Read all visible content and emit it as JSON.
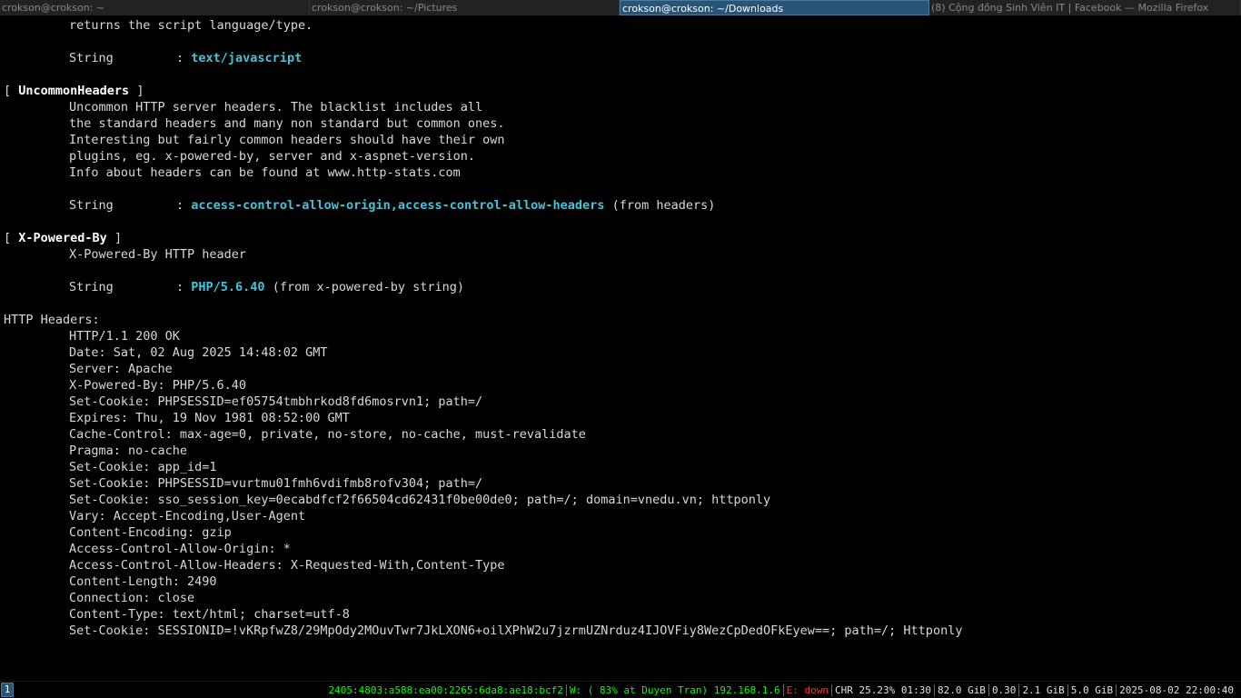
{
  "tabs": [
    {
      "title": "crokson@crokson: ~",
      "active": false
    },
    {
      "title": "crokson@crokson: ~/Pictures",
      "active": false
    },
    {
      "title": "crokson@crokson: ~/Downloads",
      "active": true
    },
    {
      "title": "(8) Cộng đồng Sinh Viên IT | Facebook — Mozilla Firefox",
      "active": false
    }
  ],
  "terminal": {
    "script_type": {
      "desc": "returns the script language/type.",
      "key": "String",
      "colon": ":",
      "value": "text/javascript"
    },
    "uncommon_headers": {
      "open": "[ ",
      "name": "UncommonHeaders",
      "close": " ]",
      "desc": [
        "Uncommon HTTP server headers. The blacklist includes all",
        "the standard headers and many non standard but common ones.",
        "Interesting but fairly common headers should have their own",
        "plugins, eg. x-powered-by, server and x-aspnet-version.",
        "Info about headers can be found at www.http-stats.com"
      ],
      "key": "String",
      "colon": ":",
      "value": "access-control-allow-origin,access-control-allow-headers",
      "suffix": " (from headers)"
    },
    "x_powered_by": {
      "open": "[ ",
      "name": "X-Powered-By",
      "close": " ]",
      "desc": "X-Powered-By HTTP header",
      "key": "String",
      "colon": ":",
      "value": "PHP/5.6.40",
      "suffix": " (from x-powered-by string)"
    },
    "http_headers_title": "HTTP Headers:",
    "http_headers": [
      "HTTP/1.1 200 OK",
      "Date: Sat, 02 Aug 2025 14:48:02 GMT",
      "Server: Apache",
      "X-Powered-By: PHP/5.6.40",
      "Set-Cookie: PHPSESSID=ef05754tmbhrkod8fd6mosrvn1; path=/",
      "Expires: Thu, 19 Nov 1981 08:52:00 GMT",
      "Cache-Control: max-age=0, private, no-store, no-cache, must-revalidate",
      "Pragma: no-cache",
      "Set-Cookie: app_id=1",
      "Set-Cookie: PHPSESSID=vurtmu01fmh6vdifmb8rofv304; path=/",
      "Set-Cookie: sso_session_key=0ecabdfcf2f66504cd62431f0be00de0; path=/; domain=vnedu.vn; httponly",
      "Vary: Accept-Encoding,User-Agent",
      "Content-Encoding: gzip",
      "Access-Control-Allow-Origin: *",
      "Access-Control-Allow-Headers: X-Requested-With,Content-Type",
      "Content-Length: 2490",
      "Connection: close",
      "Content-Type: text/html; charset=utf-8",
      "Set-Cookie: SESSIONID=!vKRpfwZ8/29MpOdy2MOuvTwr7JkLXON6+oilXPhW2u7jzrmUZNrduz4IJOVFiy8WezCpDedOFkEyew==; path=/; Httponly"
    ]
  },
  "statusbar": {
    "workspace": "1",
    "ipv6": "2405:4803:a588:ea00:2265:6da8:ae18:bcf2",
    "wifi": "W: ( 83% at Duyen Tran) 192.168.1.6",
    "ethernet": "E: down",
    "battery": "CHR 25.23% 01:30",
    "disk": "82.0 GiB",
    "load": "0.30",
    "mem_used": "2.1 GiB",
    "mem_free": "5.0 GiB",
    "datetime": "2025-08-02 22:00:40",
    "colors": {
      "ok": "#00ff00",
      "bad": "#ff3030",
      "accent": "#285577",
      "value_cyan": "#3ec6de"
    }
  }
}
